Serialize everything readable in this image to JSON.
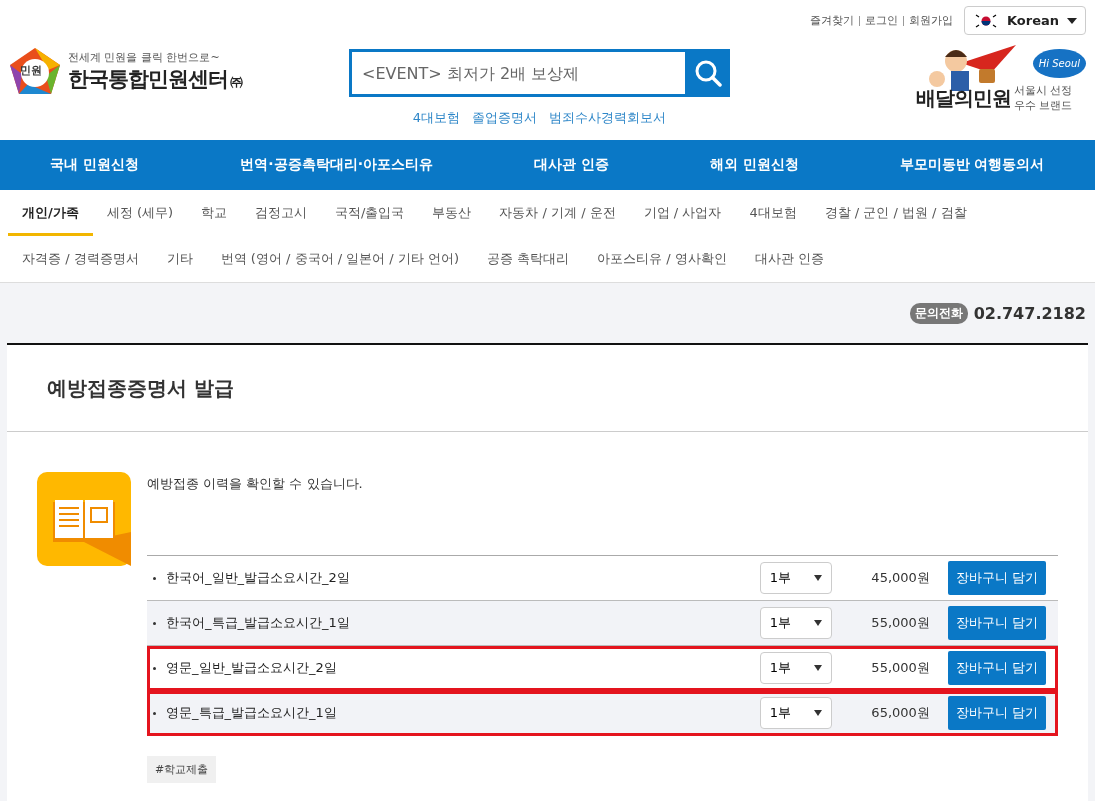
{
  "top_links": [
    "즐겨찾기",
    "로그인",
    "회원가입"
  ],
  "language": {
    "label": "Korean"
  },
  "logo": {
    "badge": "민원",
    "slogan": "전세계 민원을 클릭 한번으로~",
    "name": "한국통합민원센터",
    "suffix": "㈜"
  },
  "search": {
    "placeholder": "<EVENT> 최저가 2배 보상제"
  },
  "quick_links": [
    "4대보험",
    "졸업증명서",
    "범죄수사경력회보서"
  ],
  "promo": {
    "title": "배달의민원",
    "badge": "Hi Seoul",
    "caption_1": "서울시 선정",
    "caption_2": "우수 브랜드"
  },
  "main_nav": [
    "국내 민원신청",
    "번역·공증촉탁대리·아포스티유",
    "대사관 인증",
    "해외 민원신청",
    "부모미동반 여행동의서"
  ],
  "category_tabs": [
    {
      "label": "개인/가족",
      "selected": true
    },
    {
      "label": "세정 (세무)",
      "selected": false
    },
    {
      "label": "학교",
      "selected": false
    },
    {
      "label": "검정고시",
      "selected": false
    },
    {
      "label": "국적/출입국",
      "selected": false
    },
    {
      "label": "부동산",
      "selected": false
    },
    {
      "label": "자동차 / 기계 / 운전",
      "selected": false
    },
    {
      "label": "기업 / 사업자",
      "selected": false
    },
    {
      "label": "4대보험",
      "selected": false
    },
    {
      "label": "경찰 / 군인 / 법원 / 검찰",
      "selected": false
    },
    {
      "label": "자격증 / 경력증명서",
      "selected": false
    },
    {
      "label": "기타",
      "selected": false
    },
    {
      "label": "번역 (영어 / 중국어 / 일본어 / 기타 언어)",
      "selected": false
    },
    {
      "label": "공증 촉탁대리",
      "selected": false
    },
    {
      "label": "아포스티유 / 영사확인",
      "selected": false
    },
    {
      "label": "대사관 인증",
      "selected": false
    }
  ],
  "contact": {
    "label": "문의전화",
    "phone": "02.747.2182"
  },
  "product": {
    "title": "예방접종증명서 발급",
    "description": "예방접종 이력을 확인할 수 있습니다.",
    "options": [
      {
        "name": "한국어_일반_발급소요시간_2일",
        "quantity": "1부",
        "price": "45,000원",
        "button": "장바구니 담기",
        "highlighted": false
      },
      {
        "name": "한국어_특급_발급소요시간_1일",
        "quantity": "1부",
        "price": "55,000원",
        "button": "장바구니 담기",
        "highlighted": false
      },
      {
        "name": "영문_일반_발급소요시간_2일",
        "quantity": "1부",
        "price": "55,000원",
        "button": "장바구니 담기",
        "highlighted": true
      },
      {
        "name": "영문_특급_발급소요시간_1일",
        "quantity": "1부",
        "price": "65,000원",
        "button": "장바구니 담기",
        "highlighted": true
      }
    ],
    "tags": [
      "#학교제출"
    ]
  }
}
